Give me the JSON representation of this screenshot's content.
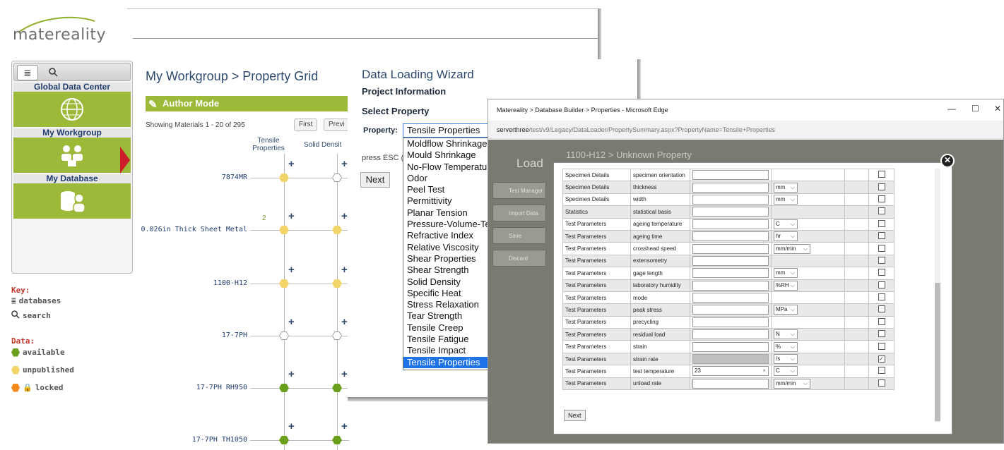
{
  "app": {
    "logo": "matereality"
  },
  "sidebar": {
    "tabs": [
      {
        "icon": "database-icon",
        "glyph": "≣"
      },
      {
        "icon": "search-icon",
        "glyph": "🔍"
      }
    ],
    "items": [
      {
        "label": "Global Data Center",
        "icon": "globe-icon"
      },
      {
        "label": "My Workgroup",
        "icon": "workgroup-icon"
      },
      {
        "label": "My Database",
        "icon": "database-user-icon"
      }
    ]
  },
  "key": {
    "title": "Key:",
    "databases": "databases",
    "search": "search"
  },
  "data_legend": {
    "title": "Data:",
    "available": "available",
    "unpublished": "unpublished",
    "locked": "locked",
    "colors": {
      "available": "#6aa01e",
      "unpublished": "#f2d46b",
      "locked": "#f08a1c"
    }
  },
  "grid": {
    "breadcrumb": "My Workgroup > Property Grid",
    "author_mode": "Author Mode",
    "showing": "Showing Materials 1 - 20 of 295",
    "first_button": "First",
    "prev_button": "Previ",
    "columns": [
      "Tensile Properties",
      "Solid Densit"
    ],
    "rows": [
      {
        "label": "7874MR",
        "c1": "unpublished",
        "c2": "empty",
        "count": ""
      },
      {
        "label": "0.026in Thick Sheet Metal",
        "c1": "unpublished",
        "c2": "unpublished",
        "count": "2"
      },
      {
        "label": "1100-H12",
        "c1": "unpublished",
        "c2": "unpublished",
        "count": ""
      },
      {
        "label": "17-7PH",
        "c1": "empty",
        "c2": "empty",
        "count": ""
      },
      {
        "label": "17-7PH RH950",
        "c1": "available",
        "c2": "available",
        "count": ""
      },
      {
        "label": "17-7PH TH1050",
        "c1": "available",
        "c2": "available",
        "count": ""
      }
    ],
    "plus": "+"
  },
  "wizard": {
    "title": "Data Loading Wizard",
    "subtitle": "Project Information",
    "select_property": "Select Property",
    "property_label": "Property:",
    "selected": "Tensile Properties",
    "esc_text": "press ESC (",
    "next_button": "Next",
    "options": [
      "Moldflow Shrinkage",
      "Mould Shrinkage",
      "No-Flow Temperatur",
      "Odor",
      "Peel Test",
      "Permittivity",
      "Planar Tension",
      "Pressure-Volume-Te",
      "Refractive Index",
      "Relative Viscosity",
      "Shear Properties",
      "Shear Strength",
      "Solid Density",
      "Specific Heat",
      "Stress Relaxation",
      "Tear Strength",
      "Tensile Creep",
      "Tensile Fatigue",
      "Tensile Impact",
      "Tensile Properties"
    ]
  },
  "edge": {
    "title": "Matereality > Database Builder > Properties - Microsoft Edge",
    "url_host": "serverthree",
    "url_path": "/test/v9/Legacy/DataLoader/PropertySummary.aspx?PropertyName=Tensile+Properties",
    "minimize": "—",
    "maximize": "☐",
    "close": "✕",
    "bg_title": "1100-H12 > Unknown Property",
    "bg_load": "Load",
    "side_buttons": [
      "Test Manager",
      "Import Data",
      "Save",
      "Discard"
    ],
    "modal_close": "✕",
    "next_button": "Next",
    "rows": [
      {
        "group": "Specimen Details",
        "name": "specimen orientation",
        "value": "",
        "unit": "",
        "checked": false
      },
      {
        "group": "Specimen Details",
        "name": "thickness",
        "value": "",
        "unit": "mm",
        "checked": false
      },
      {
        "group": "Specimen Details",
        "name": "width",
        "value": "",
        "unit": "mm",
        "checked": false
      },
      {
        "group": "Statistics",
        "name": "statistical basis",
        "value": "",
        "unit": "",
        "checked": false
      },
      {
        "group": "Test Parameters",
        "name": "ageing temperature",
        "value": "",
        "unit": "C",
        "checked": false
      },
      {
        "group": "Test Parameters",
        "name": "ageing time",
        "value": "",
        "unit": "hr",
        "checked": false
      },
      {
        "group": "Test Parameters",
        "name": "crosshead speed",
        "value": "",
        "unit": "mm/min",
        "checked": false
      },
      {
        "group": "Test Parameters",
        "name": "extensometry",
        "value": "",
        "unit": "",
        "checked": false
      },
      {
        "group": "Test Parameters",
        "name": "gage length",
        "value": "",
        "unit": "mm",
        "checked": false
      },
      {
        "group": "Test Parameters",
        "name": "laboratory humidity",
        "value": "",
        "unit": "%RH",
        "checked": false
      },
      {
        "group": "Test Parameters",
        "name": "mode",
        "value": "",
        "unit": "",
        "checked": false
      },
      {
        "group": "Test Parameters",
        "name": "peak stress",
        "value": "",
        "unit": "MPa",
        "checked": false
      },
      {
        "group": "Test Parameters",
        "name": "precycling",
        "value": "",
        "unit": "",
        "checked": false
      },
      {
        "group": "Test Parameters",
        "name": "residual load",
        "value": "",
        "unit": "N",
        "checked": false
      },
      {
        "group": "Test Parameters",
        "name": "strain",
        "value": "",
        "unit": "%",
        "checked": false
      },
      {
        "group": "Test Parameters",
        "name": "strain rate",
        "value": "",
        "unit": "/s",
        "checked": true,
        "disabled": true
      },
      {
        "group": "Test Parameters",
        "name": "test temperature",
        "value": "23",
        "unit": "C",
        "checked": false
      },
      {
        "group": "Test Parameters",
        "name": "unload rate",
        "value": "",
        "unit": "mm/min",
        "checked": false
      }
    ]
  }
}
